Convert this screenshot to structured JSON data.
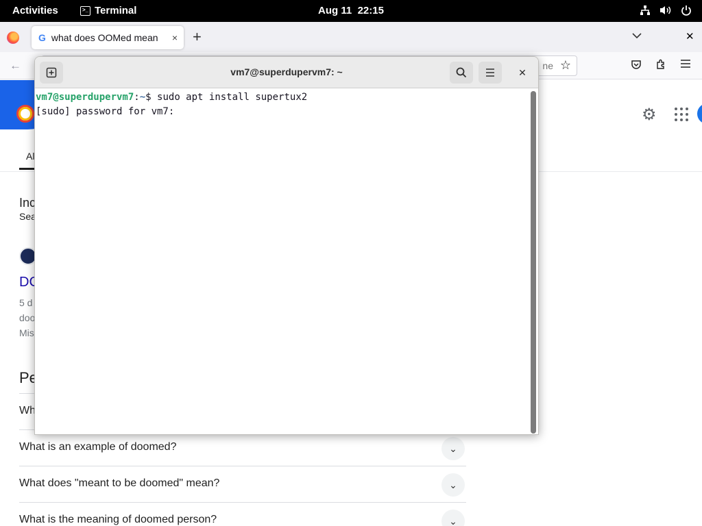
{
  "topbar": {
    "activities": "Activities",
    "app_name": "Terminal",
    "date": "Aug 11",
    "time": "22:15",
    "icons": [
      "network-icon",
      "volume-icon",
      "power-icon"
    ]
  },
  "browser": {
    "tab_title": "what does OOMed mean",
    "tab_close": "×",
    "new_tab": "+",
    "url_fragment": "ne"
  },
  "google": {
    "tab_all": "Al",
    "snippet_line1": "Inc",
    "snippet_line2": "Sea",
    "result_title": "DC",
    "result_meta": [
      "5 d",
      "doo",
      "Mis"
    ],
    "paa_heading": "Pe",
    "paa_items": [
      "Wh",
      "What is an example of doomed?",
      "What does \"meant to be doomed\" mean?",
      "What is the meaning of doomed person?"
    ]
  },
  "terminal": {
    "title": "vm7@superdupervm7: ~",
    "prompt_user": "vm7@superdupervm7",
    "prompt_sep": ":",
    "prompt_path": "~",
    "prompt_symbol": "$",
    "command": " sudo apt install supertux2",
    "output_line": "[sudo] password for vm7:"
  },
  "colors": {
    "prompt_user": "#26a269",
    "link": "#1a0dab",
    "topbar_bg": "#000000"
  }
}
